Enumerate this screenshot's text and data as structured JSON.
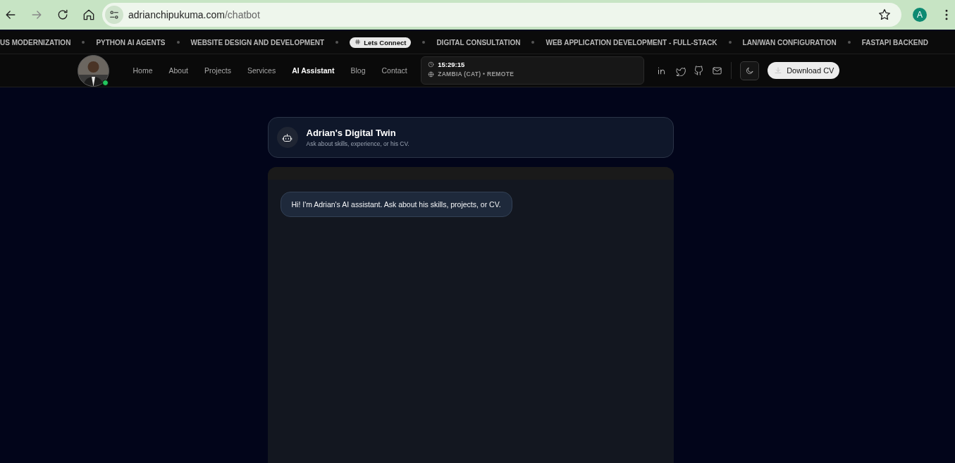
{
  "browser": {
    "url_host": "adrianchipukuma.com",
    "url_path": "/chatbot",
    "profile": "A"
  },
  "ticker": [
    {
      "kind": "text",
      "label": "US MODERNIZATION"
    },
    {
      "kind": "text",
      "label": "PYTHON AI AGENTS"
    },
    {
      "kind": "text",
      "label": "WEBSITE DESIGN AND DEVELOPMENT"
    },
    {
      "kind": "pill",
      "label": "Lets Connect"
    },
    {
      "kind": "text",
      "label": "DIGITAL CONSULTATION"
    },
    {
      "kind": "text",
      "label": "WEB APPLICATION DEVELOPMENT - FULL-STACK"
    },
    {
      "kind": "text",
      "label": "LAN/WAN CONFIGURATION"
    },
    {
      "kind": "text",
      "label": "FASTAPI BACKEND"
    }
  ],
  "nav": {
    "online": true,
    "links": [
      {
        "label": "Home",
        "selected": false
      },
      {
        "label": "About",
        "selected": false
      },
      {
        "label": "Projects",
        "selected": false
      },
      {
        "label": "Services",
        "selected": false
      },
      {
        "label": "AI Assistant",
        "selected": true
      },
      {
        "label": "Blog",
        "selected": false
      },
      {
        "label": "Contact",
        "selected": false
      }
    ],
    "clock": {
      "time": "15:29:15",
      "location": "ZAMBIA (CAT) • REMOTE"
    },
    "download": "Download CV"
  },
  "chat": {
    "title": "Adrian's Digital Twin",
    "subtitle": "Ask about skills, experience, or his CV.",
    "messages": [
      {
        "text": "Hi! I'm Adrian's AI assistant. Ask about his skills, projects, or CV."
      }
    ]
  }
}
